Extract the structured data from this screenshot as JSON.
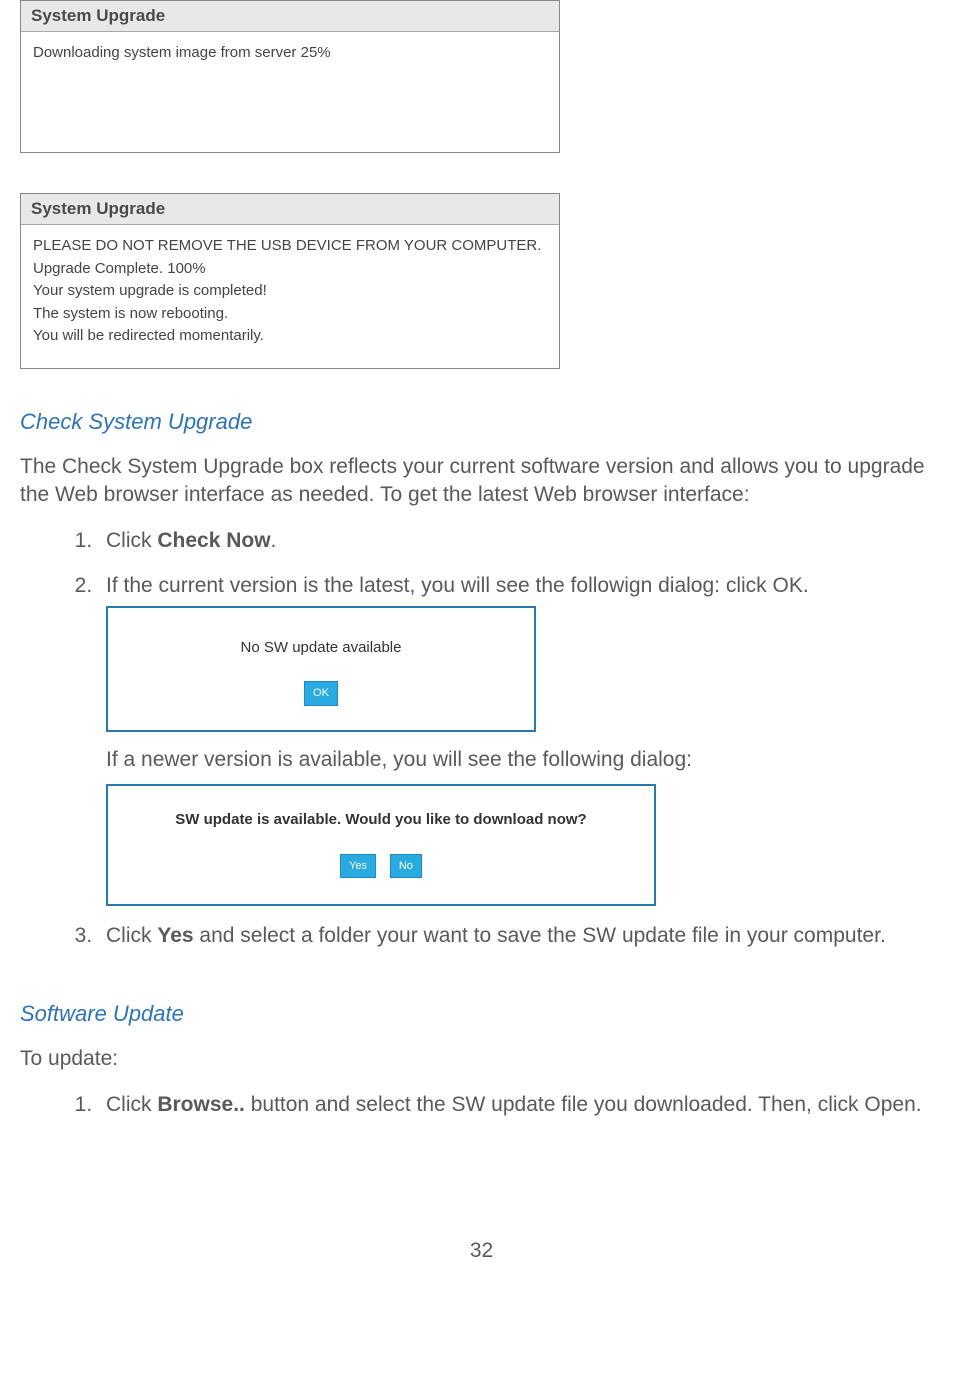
{
  "panels": {
    "upgrade1": {
      "title": "System Upgrade",
      "body": "Downloading system image from server 25%"
    },
    "upgrade2": {
      "title": "System Upgrade",
      "lines": [
        "PLEASE DO NOT REMOVE THE USB DEVICE FROM YOUR COMPUTER.",
        "Upgrade Complete. 100%",
        "Your system upgrade is completed!",
        "The system is now rebooting.",
        "You will be redirected momentarily."
      ]
    }
  },
  "sections": {
    "checkUpgrade": {
      "heading": "Check System Upgrade",
      "intro": "The Check System Upgrade box reflects your current software version and allows you to upgrade the Web browser interface as needed.  To get the latest Web browser interface:",
      "step1_pre": "Click ",
      "step1_bold": "Check Now",
      "step1_post": ".",
      "step2": "If the current version is the latest, you will see the followign dialog: click OK.",
      "step2_after": "If a newer version is available, you will see the following dialog:",
      "step3_pre": "Click ",
      "step3_bold": "Yes",
      "step3_post": " and select a folder your want to save the SW update file in your computer."
    },
    "softwareUpdate": {
      "heading": "Software Update",
      "intro": "To update:",
      "step1_pre": "Click ",
      "step1_bold": "Browse..",
      "step1_post": " button and select the SW update file you downloaded. Then, click Open."
    }
  },
  "dialogs": {
    "noUpdate": {
      "text": "No SW update available",
      "ok": "OK"
    },
    "updateAvail": {
      "text": "SW update is available. Would you like to download now?",
      "yes": "Yes",
      "no": "No"
    }
  },
  "pageNumber": "32"
}
